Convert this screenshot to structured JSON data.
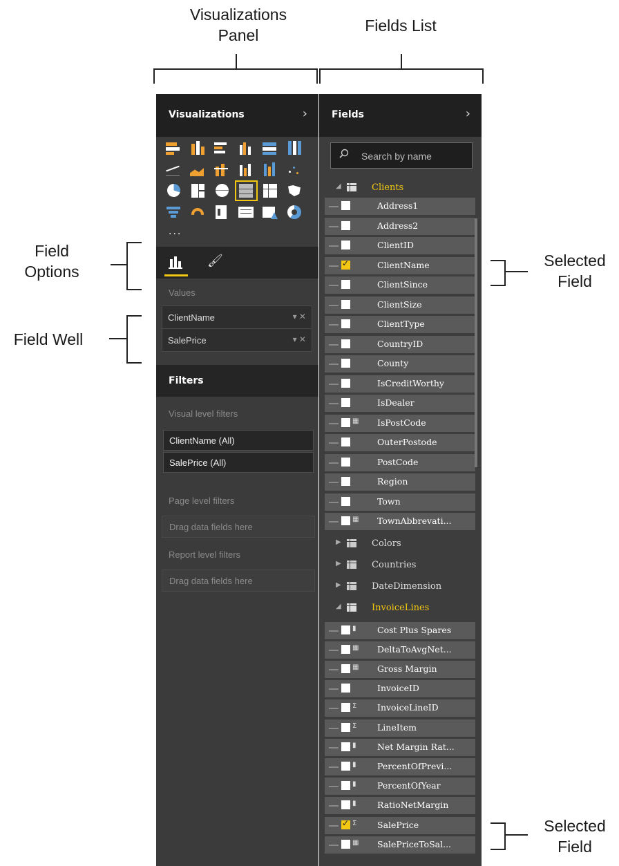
{
  "annotations": {
    "viz_panel": "Visualizations\nPanel",
    "fields_list": "Fields List",
    "field_options": "Field\nOptions",
    "field_well": "Field Well",
    "selected_field_1": "Selected\nField",
    "selected_field_2": "Selected\nField"
  },
  "visualizations": {
    "title": "Visualizations",
    "expand_icon": "chevron-right-icon",
    "more": "...",
    "values_label": "Values",
    "wells": [
      {
        "name": "ClientName"
      },
      {
        "name": "SalePrice"
      }
    ],
    "well_controls": "▾ ✕",
    "accent": "#f2c811"
  },
  "filters": {
    "title": "Filters",
    "visual_level": "Visual level filters",
    "visual_items": [
      "ClientName (All)",
      "SalePrice (All)"
    ],
    "page_level": "Page level filters",
    "page_drop": "Drag data fields here",
    "report_level": "Report level filters",
    "report_drop": "Drag data fields here"
  },
  "fields": {
    "title": "Fields",
    "search_placeholder": "Search by name",
    "clients_table": "Clients",
    "clients_fields": [
      {
        "name": "Address1",
        "checked": false,
        "type": ""
      },
      {
        "name": "Address2",
        "checked": false,
        "type": ""
      },
      {
        "name": "ClientID",
        "checked": false,
        "type": ""
      },
      {
        "name": "ClientName",
        "checked": true,
        "type": ""
      },
      {
        "name": "ClientSince",
        "checked": false,
        "type": ""
      },
      {
        "name": "ClientSize",
        "checked": false,
        "type": ""
      },
      {
        "name": "ClientType",
        "checked": false,
        "type": ""
      },
      {
        "name": "CountryID",
        "checked": false,
        "type": ""
      },
      {
        "name": "County",
        "checked": false,
        "type": ""
      },
      {
        "name": "IsCreditWorthy",
        "checked": false,
        "type": ""
      },
      {
        "name": "IsDealer",
        "checked": false,
        "type": ""
      },
      {
        "name": "IsPostCode",
        "checked": false,
        "type": "fx"
      },
      {
        "name": "OuterPostode",
        "checked": false,
        "type": ""
      },
      {
        "name": "PostCode",
        "checked": false,
        "type": ""
      },
      {
        "name": "Region",
        "checked": false,
        "type": ""
      },
      {
        "name": "Town",
        "checked": false,
        "type": ""
      },
      {
        "name": "TownAbbrevati...",
        "checked": false,
        "type": "fx"
      }
    ],
    "collapsed_tables": [
      "Colors",
      "Countries",
      "DateDimension"
    ],
    "invoice_table": "InvoiceLines",
    "invoice_fields": [
      {
        "name": "Cost Plus Spares",
        "checked": false,
        "type": "calc"
      },
      {
        "name": "DeltaToAvgNet...",
        "checked": false,
        "type": "fx"
      },
      {
        "name": "Gross Margin",
        "checked": false,
        "type": "fx"
      },
      {
        "name": "InvoiceID",
        "checked": false,
        "type": ""
      },
      {
        "name": "InvoiceLineID",
        "checked": false,
        "type": "Σ"
      },
      {
        "name": "LineItem",
        "checked": false,
        "type": "Σ"
      },
      {
        "name": "Net Margin Rat...",
        "checked": false,
        "type": "calc"
      },
      {
        "name": "PercentOfPrevi...",
        "checked": false,
        "type": "calc"
      },
      {
        "name": "PercentOfYear",
        "checked": false,
        "type": "calc"
      },
      {
        "name": "RatioNetMargin",
        "checked": false,
        "type": "calc"
      },
      {
        "name": "SalePrice",
        "checked": true,
        "type": "Σ"
      },
      {
        "name": "SalePriceToSal...",
        "checked": false,
        "type": "fx"
      }
    ]
  }
}
